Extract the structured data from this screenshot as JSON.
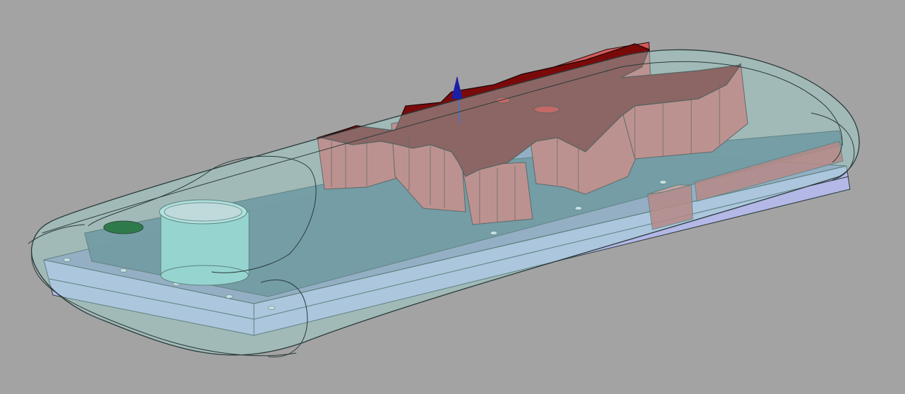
{
  "viewport": {
    "background": "#a3a3a3"
  },
  "colors": {
    "shell_fill": "#9fd6d2",
    "shell_edge": "#2a3a3a",
    "base_plate": "#8a8fb8",
    "base_plate_side": "#b4b8e6",
    "pcb": "#4f6d80",
    "logo_top": "#7a0a0a",
    "logo_side": "#d45a5a",
    "axis_blue": "#1b1fa8",
    "hole": "#dfe6ee",
    "connector": "#c94a4a"
  },
  "objects": [
    {
      "name": "transparent-shell",
      "icon": "shell-shape"
    },
    {
      "name": "base-plate",
      "icon": "plate-shape"
    },
    {
      "name": "pcb-board",
      "icon": "board-shape"
    },
    {
      "name": "dragon-logo-extrusion",
      "icon": "logo-shape"
    },
    {
      "name": "cylinder-boss",
      "icon": "cylinder-shape"
    },
    {
      "name": "side-connector",
      "icon": "connector-shape"
    },
    {
      "name": "z-axis-indicator",
      "icon": "arrow-icon"
    }
  ]
}
